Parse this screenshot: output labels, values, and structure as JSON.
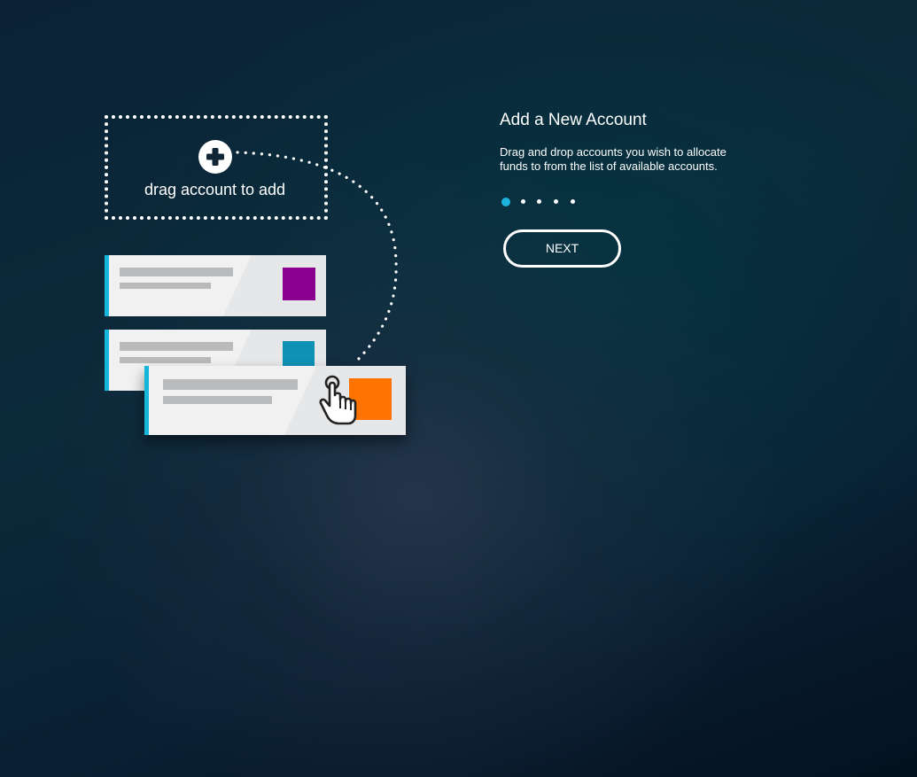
{
  "illustration": {
    "drop_zone_label": "drag account to add",
    "icons": {
      "plus": "plus-circle-icon",
      "hand": "hand-pointer-icon"
    },
    "cards": [
      {
        "swatch_color": "#8b0091"
      },
      {
        "swatch_color": "#0f91b6"
      },
      {
        "swatch_color": "#ff7300"
      }
    ],
    "accent_color": "#16b6db"
  },
  "panel": {
    "title": "Add a New Account",
    "description": "Drag and drop accounts you wish to allocate funds to from the list of available accounts.",
    "pager": {
      "total": 5,
      "current": 1,
      "active_color": "#1db2de"
    },
    "next_label": "NEXT"
  }
}
